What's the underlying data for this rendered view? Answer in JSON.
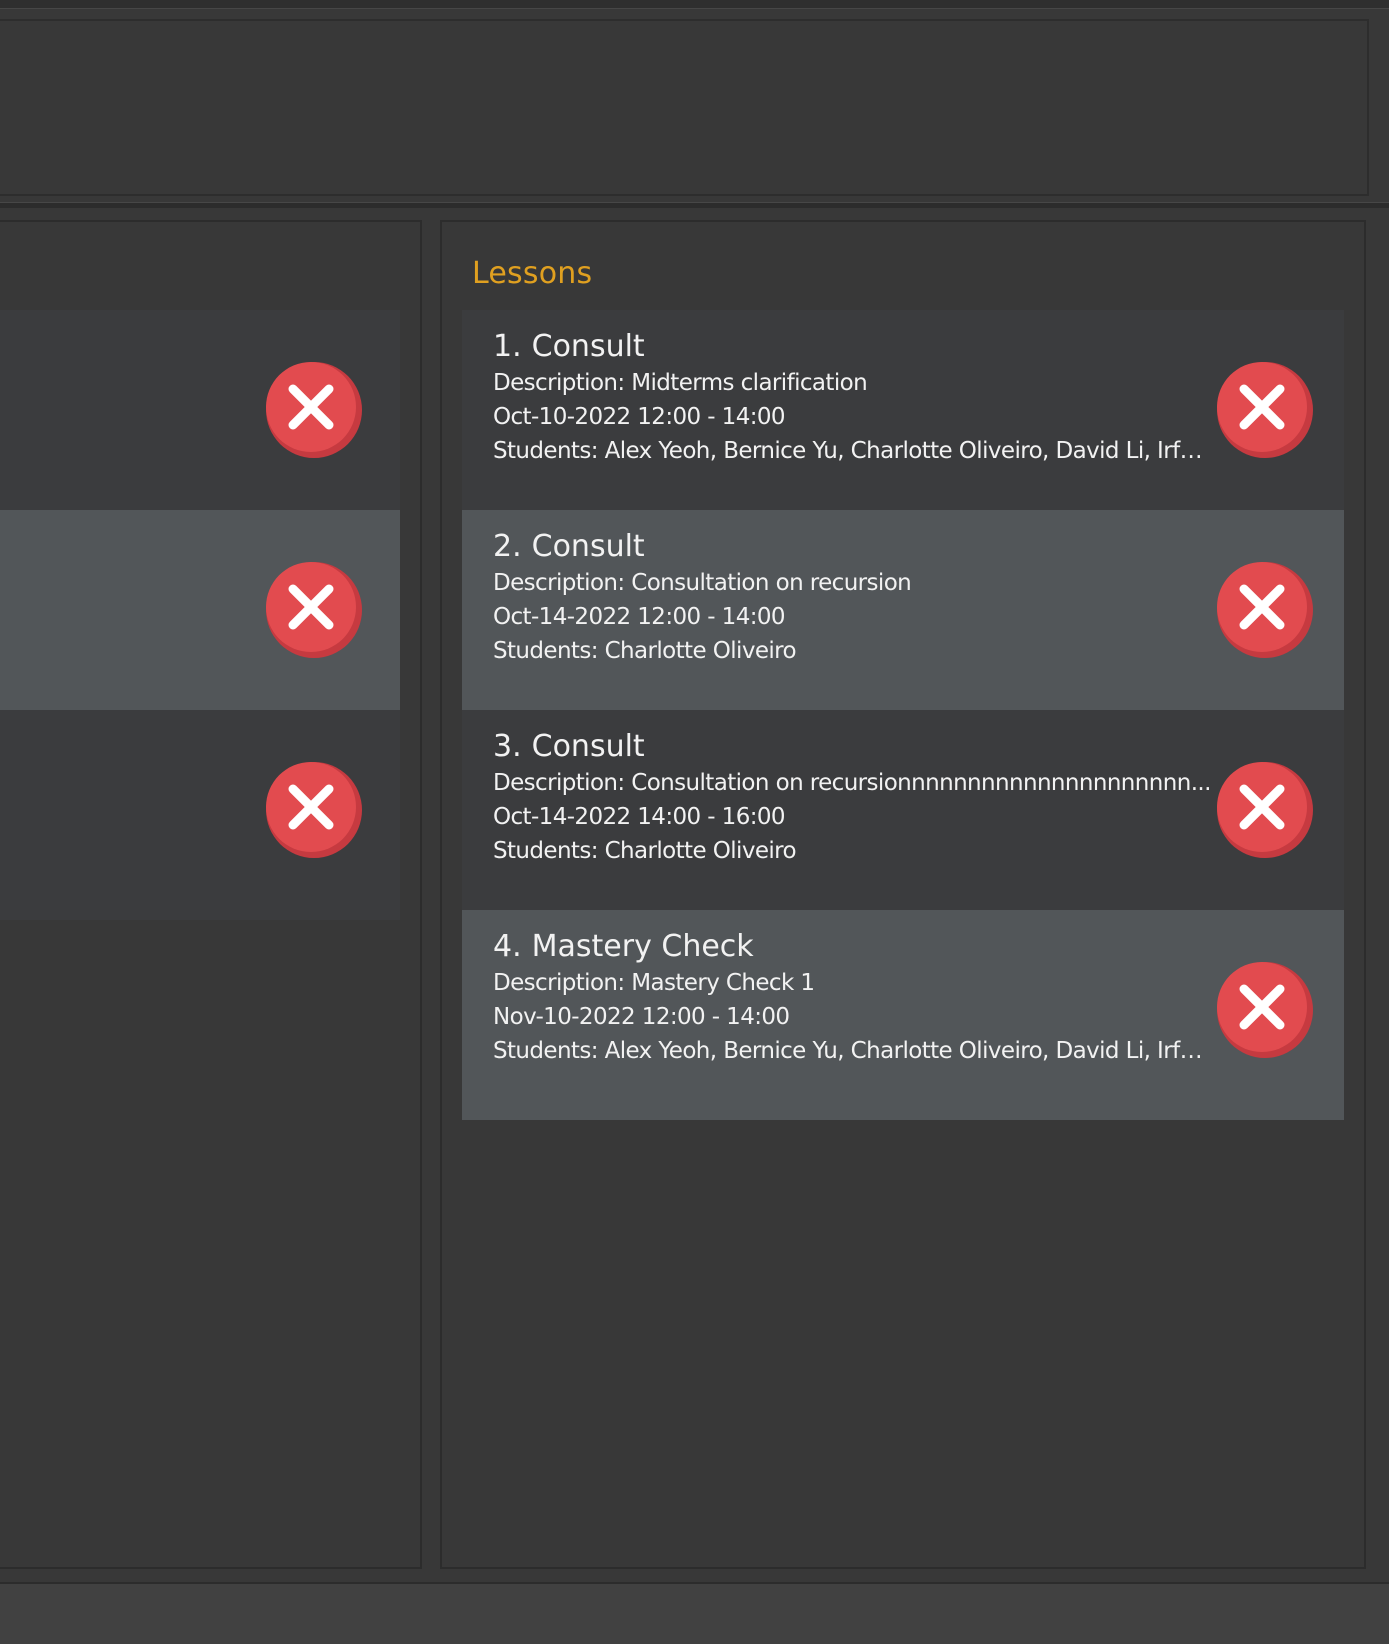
{
  "lessons_panel": {
    "title": "Lessons",
    "items": [
      {
        "index": "1.",
        "name": "Consult",
        "description": "Description: Midterms clarification",
        "datetime": "Oct-10-2022 12:00 - 14:00",
        "students": "Students: Alex Yeoh, Bernice Yu, Charlotte Oliveiro, David Li, Irfa..."
      },
      {
        "index": "2.",
        "name": "Consult",
        "description": "Description: Consultation on recursion",
        "datetime": "Oct-14-2022 12:00 - 14:00",
        "students": "Students: Charlotte Oliveiro"
      },
      {
        "index": "3.",
        "name": "Consult",
        "description": "Description: Consultation on recursionnnnnnnnnnnnnnnnnnnnn...",
        "datetime": "Oct-14-2022 14:00 - 16:00",
        "students": "Students: Charlotte Oliveiro"
      },
      {
        "index": "4.",
        "name": "Mastery Check",
        "description": "Description: Mastery Check 1",
        "datetime": "Nov-10-2022 12:00 - 14:00",
        "students": "Students: Alex Yeoh, Bernice Yu, Charlotte Oliveiro, David Li, Irfa..."
      }
    ]
  },
  "colors": {
    "panel_title": "#e0a020",
    "delete_button": "#e24b4f",
    "card_odd": "#3b3c3e",
    "card_even": "#525659"
  },
  "icons": {
    "delete": "close-circle-icon"
  }
}
